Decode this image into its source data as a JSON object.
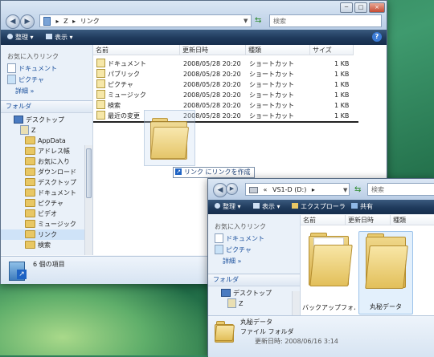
{
  "win1": {
    "controls": [
      "─",
      "□",
      "×"
    ],
    "address": {
      "path_root": "Z",
      "path_current": "リンク",
      "sep": "▸"
    },
    "search_placeholder": "検索",
    "toolbar": {
      "organize": "整理",
      "views": "表示"
    },
    "navpane": {
      "favorites_header": "お気に入りリンク",
      "favorites": [
        "ドキュメント",
        "ピクチャ"
      ],
      "more": "詳細",
      "folders_header": "フォルダ",
      "tree": [
        "デスクトップ",
        "Z",
        "AppData",
        "アドレス帳",
        "お気に入り",
        "ダウンロード",
        "デスクトップ",
        "ドキュメント",
        "ピクチャ",
        "ビデオ",
        "ミュージック",
        "リンク",
        "検索"
      ]
    },
    "columns": [
      "名前",
      "更新日時",
      "種類",
      "サイズ"
    ],
    "rows": [
      {
        "name": "ドキュメント",
        "date": "2008/05/28 20:20",
        "type": "ショートカット",
        "size": "1 KB"
      },
      {
        "name": "パブリック",
        "date": "2008/05/28 20:20",
        "type": "ショートカット",
        "size": "1 KB"
      },
      {
        "name": "ピクチャ",
        "date": "2008/05/28 20:20",
        "type": "ショートカット",
        "size": "1 KB"
      },
      {
        "name": "ミュージック",
        "date": "2008/05/28 20:20",
        "type": "ショートカット",
        "size": "1 KB"
      },
      {
        "name": "検索",
        "date": "2008/05/28 20:20",
        "type": "ショートカット",
        "size": "1 KB"
      },
      {
        "name": "最近の変更",
        "date": "2008/05/28 20:20",
        "type": "ショートカット",
        "size": "1 KB"
      }
    ],
    "status": "6 個の項目",
    "drag_tip": "リンク にリンクを作成"
  },
  "win2": {
    "address": {
      "prefix": "«",
      "drive": "VS1-D (D:)",
      "sep": "▸"
    },
    "search_placeholder": "検索",
    "toolbar": {
      "organize": "整理",
      "views": "表示",
      "explorer": "エクスプローラ",
      "share": "共有"
    },
    "navpane": {
      "favorites_header": "お気に入りリンク",
      "favorites": [
        "ドキュメント",
        "ピクチャ"
      ],
      "more": "詳細",
      "folders_header": "フォルダ",
      "tree": [
        "デスクトップ",
        "Z"
      ]
    },
    "columns": [
      "名前",
      "更新日時",
      "種類"
    ],
    "items": [
      {
        "name": "バックアップフォル"
      },
      {
        "name": "丸秘データ"
      }
    ],
    "details": {
      "name": "丸秘データ",
      "type": "ファイル フォルダ",
      "date_label": "更新日時:",
      "date": "2008/06/16 3:14"
    }
  }
}
